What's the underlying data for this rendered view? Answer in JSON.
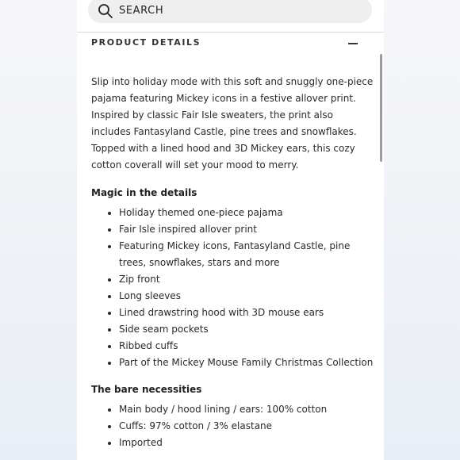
{
  "search": {
    "placeholder": "SEARCH",
    "icon": "search-icon"
  },
  "section": {
    "title": "PRODUCT DETAILS",
    "toggle_icon": "minus-icon"
  },
  "description": "Slip into holiday mode with this soft and snuggly one-piece pajama featuring Mickey icons in a festive allover print. Inspired by classic Fair Isle sweaters, the print also includes Fantasyland Castle, pine trees and snowflakes. Topped with a lined hood and 3D Mickey ears, this cozy cotton coverall will set your mood to merry.",
  "magic": {
    "heading": "Magic in the details",
    "items": [
      "Holiday themed one-piece pajama",
      "Fair Isle inspired allover print",
      "Featuring Mickey icons, Fantasyland Castle, pine trees, snowflakes, stars and more",
      "Zip front",
      "Long sleeves",
      "Lined drawstring hood with 3D mouse ears",
      "Side seam pockets",
      "Ribbed cuffs",
      "Part of the Mickey Mouse Family Christmas Collection"
    ]
  },
  "necessities": {
    "heading": "The bare necessities",
    "items": [
      "Main body / hood lining / ears: 100% cotton",
      "Cuffs: 97% cotton / 3% elastane",
      "Imported"
    ]
  },
  "colors": {
    "page_bg": "#ffffff",
    "search_bg": "#efefef",
    "text": "#2a2a2a",
    "rule": "#d9d9d9"
  }
}
